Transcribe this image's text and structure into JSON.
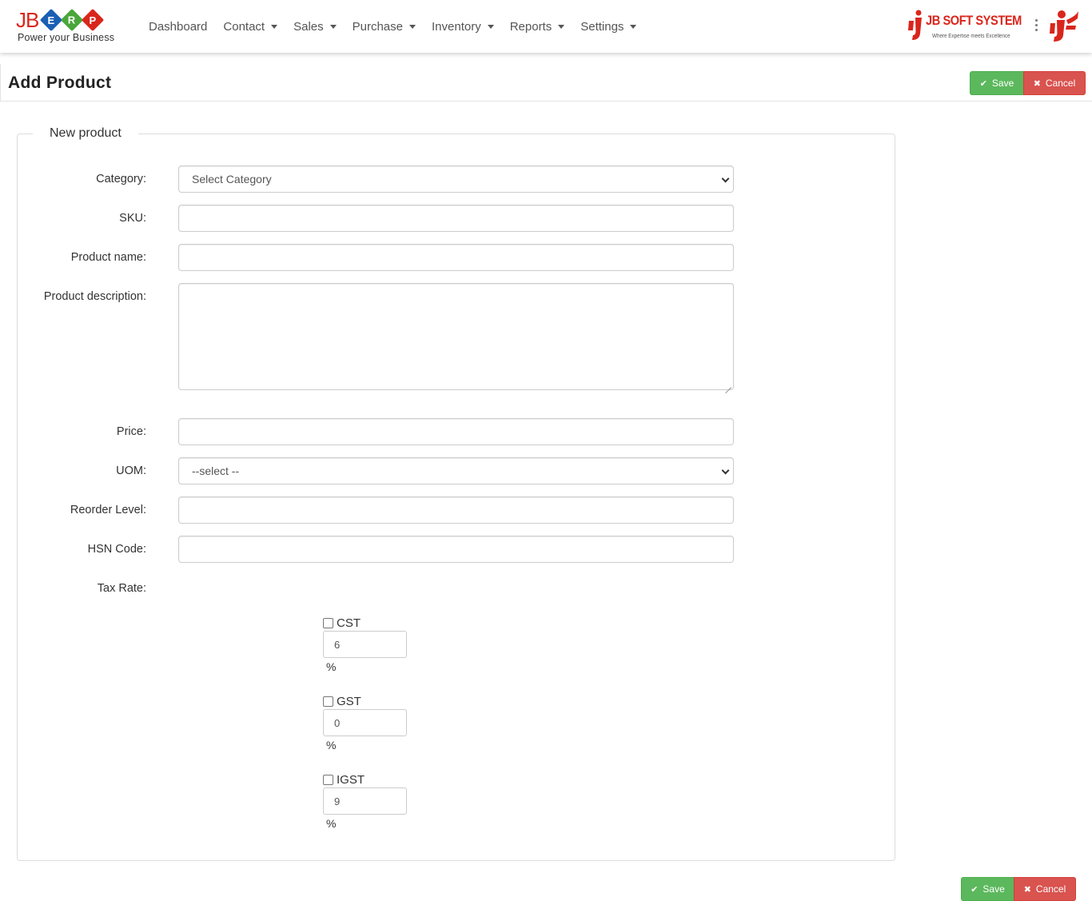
{
  "logo": {
    "letters_jb": "JB",
    "letters": [
      "E",
      "R",
      "P"
    ],
    "letter_colors": [
      "#1a5fb4",
      "#4aa63a",
      "#d9261c"
    ],
    "tagline": "Power your Business"
  },
  "nav": {
    "items": [
      {
        "label": "Dashboard",
        "dropdown": false
      },
      {
        "label": "Contact",
        "dropdown": true
      },
      {
        "label": "Sales",
        "dropdown": true
      },
      {
        "label": "Purchase",
        "dropdown": true
      },
      {
        "label": "Inventory",
        "dropdown": true
      },
      {
        "label": "Reports",
        "dropdown": true
      },
      {
        "label": "Settings",
        "dropdown": true
      }
    ]
  },
  "brand": {
    "name": "JB SOFT SYSTEM",
    "tagline": "Where Expertise meets Excellence",
    "color": "#d9261c"
  },
  "page": {
    "title": "Add Product",
    "save_label": "Save",
    "cancel_label": "Cancel",
    "save_icon": "check-icon",
    "cancel_icon": "close-icon"
  },
  "form": {
    "legend": "New product",
    "category_label": "Category:",
    "category_value": "Select Category",
    "sku_label": "SKU:",
    "product_name_label": "Product name:",
    "description_label": "Product description:",
    "price_label": "Price:",
    "uom_label": "UOM:",
    "uom_value": "--select --",
    "reorder_label": "Reorder Level:",
    "hsn_label": "HSN Code:",
    "tax_rate_label": "Tax Rate:",
    "taxes": [
      {
        "name": "CST",
        "value": "6",
        "unit": "%",
        "checked": false
      },
      {
        "name": "GST",
        "value": "0",
        "unit": "%",
        "checked": false
      },
      {
        "name": "IGST",
        "value": "9",
        "unit": "%",
        "checked": false
      }
    ]
  },
  "colors": {
    "save": "#5cb85c",
    "cancel": "#d9534f"
  }
}
